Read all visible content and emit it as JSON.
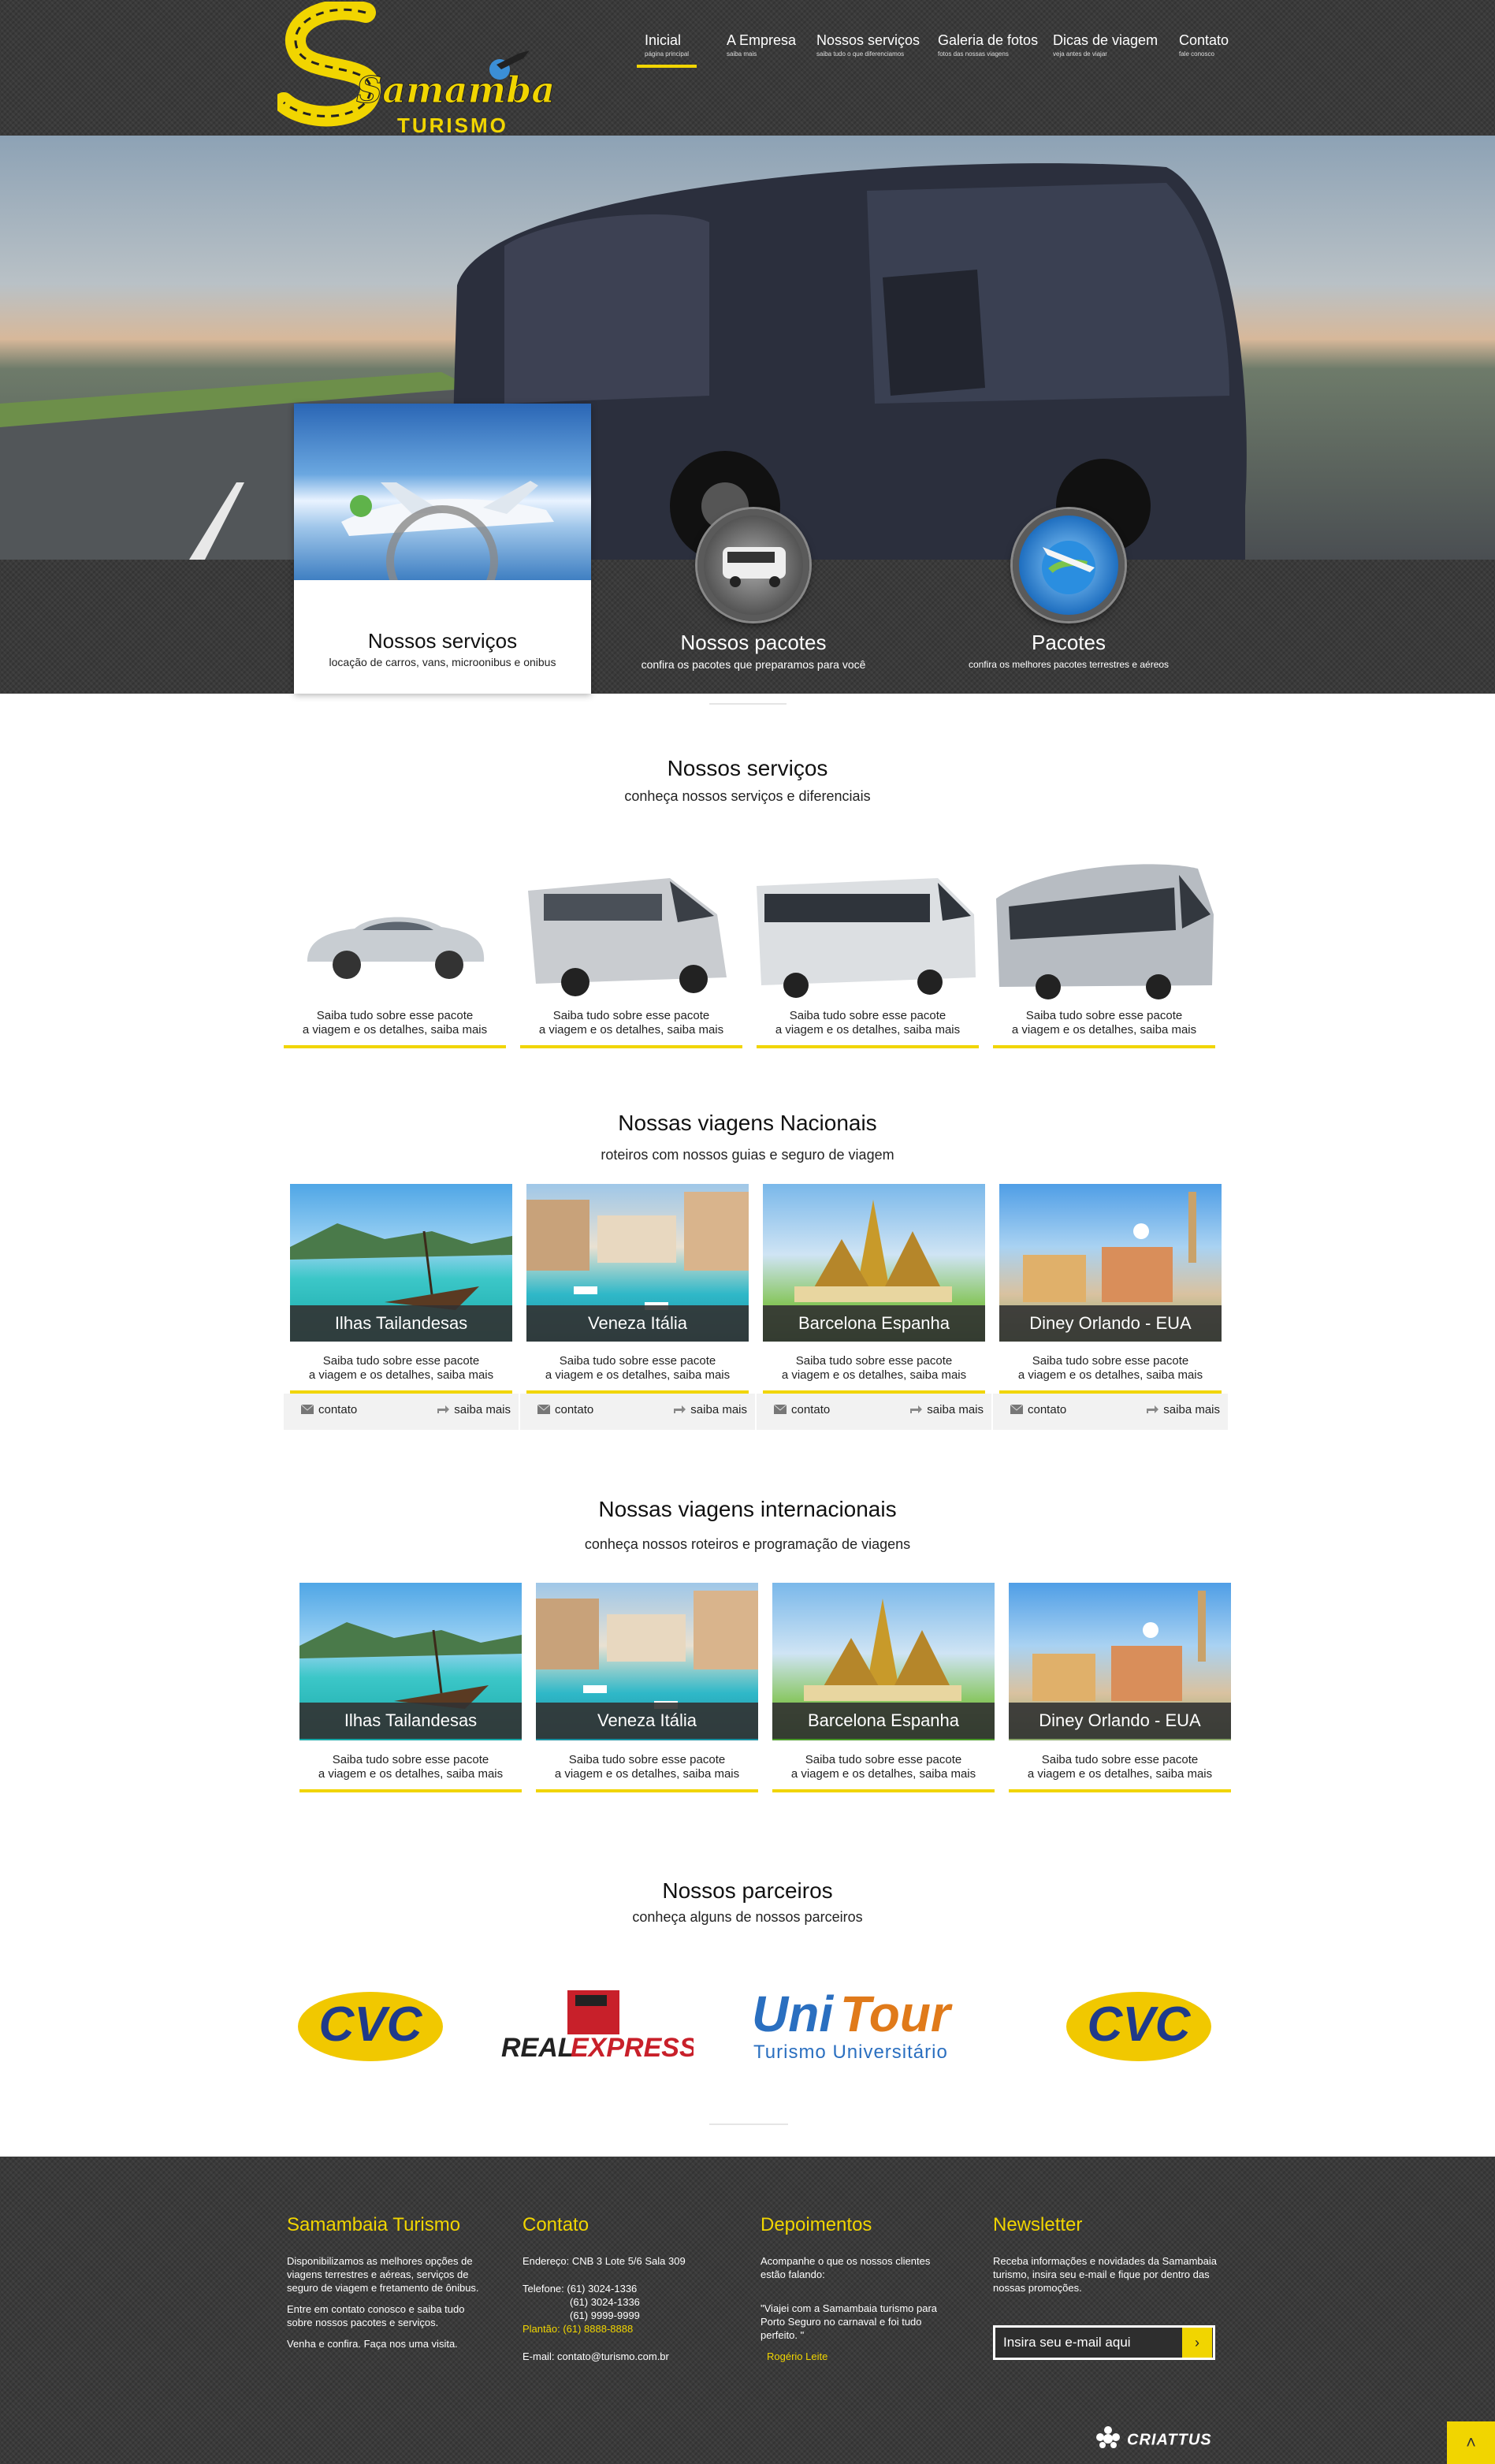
{
  "brand": {
    "script": "Samambaia",
    "word": "TURISMO",
    "accent": "#f1d500"
  },
  "nav": [
    {
      "label": "Inicial",
      "sub": "página principal",
      "active": true
    },
    {
      "label": "A Empresa",
      "sub": "saiba mais"
    },
    {
      "label": "Nossos serviços",
      "sub": "saiba tudo o que diferenciamos"
    },
    {
      "label": "Galeria de fotos",
      "sub": "fotos das nossas viagens"
    },
    {
      "label": "Dicas de viagem",
      "sub": "veja antes de viajar"
    },
    {
      "label": "Contato",
      "sub": "fale conosco"
    }
  ],
  "features": [
    {
      "title": "Nossos serviços",
      "desc": "locação de carros, vans, microonibus e onibus"
    },
    {
      "title": "Nossos pacotes",
      "desc": "confira os pacotes que preparamos para você"
    },
    {
      "title": "Pacotes",
      "desc": "confira os melhores pacotes terrestres e aéreos"
    }
  ],
  "services": {
    "title": "Nossos serviços",
    "subtitle": "conheça nossos serviços e diferenciais",
    "items": [
      {
        "line1": "Saiba tudo sobre esse pacote",
        "line2": "a viagem e os detalhes, saiba mais"
      },
      {
        "line1": "Saiba tudo sobre esse pacote",
        "line2": "a viagem e os detalhes, saiba mais"
      },
      {
        "line1": "Saiba tudo sobre esse pacote",
        "line2": "a viagem e os detalhes, saiba mais"
      },
      {
        "line1": "Saiba tudo sobre esse pacote",
        "line2": "a viagem e os detalhes, saiba mais"
      }
    ]
  },
  "nacionais": {
    "title": "Nossas viagens Nacionais",
    "subtitle": "roteiros com nossos guias e seguro de viagem",
    "contact_label": "contato",
    "more_label": "saiba mais",
    "items": [
      {
        "name": "Ilhas Tailandesas",
        "line1": "Saiba tudo sobre esse pacote",
        "line2": "a viagem e os detalhes, saiba mais"
      },
      {
        "name": "Veneza Itália",
        "line1": "Saiba tudo sobre esse pacote",
        "line2": "a viagem e os detalhes, saiba mais"
      },
      {
        "name": "Barcelona Espanha",
        "line1": "Saiba tudo sobre esse pacote",
        "line2": "a viagem e os detalhes, saiba mais"
      },
      {
        "name": "Diney Orlando - EUA",
        "line1": "Saiba tudo sobre esse pacote",
        "line2": "a viagem e os detalhes, saiba mais"
      }
    ]
  },
  "internacionais": {
    "title": "Nossas viagens internacionais",
    "subtitle": "conheça nossos roteiros e  programação de viagens",
    "items": [
      {
        "name": "Ilhas Tailandesas",
        "line1": "Saiba tudo sobre esse pacote",
        "line2": "a viagem e os detalhes, saiba mais"
      },
      {
        "name": "Veneza Itália",
        "line1": "Saiba tudo sobre esse pacote",
        "line2": "a viagem e os detalhes, saiba mais"
      },
      {
        "name": "Barcelona Espanha",
        "line1": "Saiba tudo sobre esse pacote",
        "line2": "a viagem e os detalhes, saiba mais"
      },
      {
        "name": "Diney Orlando - EUA",
        "line1": "Saiba tudo sobre esse pacote",
        "line2": "a viagem e os detalhes, saiba mais"
      }
    ]
  },
  "parceiros": {
    "title": "Nossos parceiros",
    "subtitle": "conheça alguns de nossos parceiros",
    "logos": [
      {
        "name": "CVC"
      },
      {
        "name": "REALEXPRESSO",
        "part1": "REAL",
        "part2": "EXPRESSO"
      },
      {
        "name": "UniTour",
        "part1": "Uni",
        "part2": "Tour",
        "tagline": "Turismo Universitário"
      },
      {
        "name": "CVC"
      }
    ]
  },
  "footer": {
    "about": {
      "title": "Samambaia Turismo",
      "p1": "Disponibilizamos as melhores opções de viagens terrestres e aéreas, serviços de seguro de viagem e fretamento de ônibus.",
      "p2": "Entre em contato conosco e saiba tudo sobre nossos pacotes e serviços.",
      "p3": "Venha e confira. Faça nos uma visita."
    },
    "contact": {
      "title": "Contato",
      "address": "Endereço: CNB 3 Lote 5/6 Sala 309",
      "phone_label": "Telefone:",
      "phone1": "(61) 3024-1336",
      "phone2": "(61) 3024-1336",
      "phone3": "(61) 9999-9999",
      "plantao": "Plantão: (61) 8888-8888",
      "email": "E-mail: contato@turismo.com.br"
    },
    "testimonials": {
      "title": "Depoimentos",
      "intro": "Acompanhe o que os nossos clientes estão falando:",
      "quote": "\"Viajei com a Samambaia turismo para Porto Seguro no carnaval e foi tudo perfeito. \"",
      "author": "Rogério Leite"
    },
    "newsletter": {
      "title": "Newsletter",
      "text": "Receba informações e novidades da Samambaia turismo, insira seu e-mail e fique por dentro das nossas promoções.",
      "placeholder": "Insira seu e-mail aqui",
      "button": "›"
    },
    "credit": "CRIATTUS",
    "totop": "˄"
  }
}
